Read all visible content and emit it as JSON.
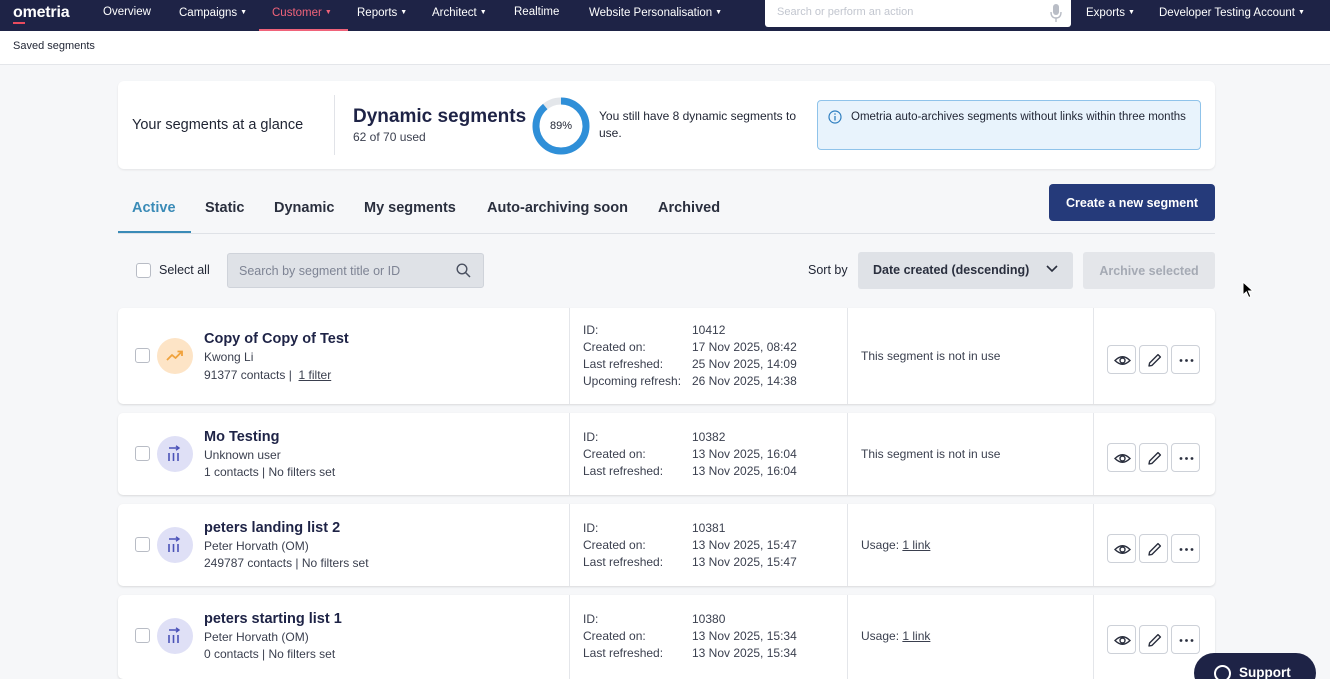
{
  "nav": {
    "logo": "ometria",
    "items": [
      {
        "label": "Overview",
        "dropdown": false
      },
      {
        "label": "Campaigns",
        "dropdown": true
      },
      {
        "label": "Customer",
        "dropdown": true,
        "active": true
      },
      {
        "label": "Reports",
        "dropdown": true
      },
      {
        "label": "Architect",
        "dropdown": true
      },
      {
        "label": "Realtime",
        "dropdown": false
      },
      {
        "label": "Website Personalisation",
        "dropdown": true
      }
    ],
    "search_placeholder": "Search or perform an action",
    "exports": "Exports",
    "account": "Developer Testing Account",
    "accent_color": "#f0637a",
    "bg_color": "#1e2346"
  },
  "breadcrumb": "Saved segments",
  "glance": {
    "title": "Your segments at a glance",
    "dynamic_title": "Dynamic segments",
    "used_text": "62 of 70 used",
    "used": 62,
    "total": 70,
    "percent_label": "89%",
    "percent": 0.89,
    "remaining_text": "You still have 8 dynamic segments to use.",
    "info_text": "Ometria auto-archives segments without links within three months"
  },
  "tabs": [
    {
      "label": "Active",
      "active": true
    },
    {
      "label": "Static"
    },
    {
      "label": "Dynamic"
    },
    {
      "label": "My segments"
    },
    {
      "label": "Auto-archiving soon"
    },
    {
      "label": "Archived"
    }
  ],
  "create_button": "Create a new segment",
  "filters": {
    "select_all": "Select all",
    "search_placeholder": "Search by segment title or ID",
    "sort_label": "Sort by",
    "sort_value": "Date created (descending)",
    "archive_button": "Archive selected"
  },
  "segments": [
    {
      "name": "Copy of Copy of Test",
      "owner": "Kwong Li",
      "contacts": "91377 contacts",
      "filters": "1 filter",
      "filters_link": true,
      "icon": "trending-up-icon",
      "icon_bg": "#fde4c6",
      "icon_color": "#f0a23c",
      "id_label": "ID:",
      "id": "10412",
      "created_label": "Created on:",
      "created": "17 Nov 2025, 08:42",
      "refreshed_label": "Last refreshed:",
      "refreshed": "25 Nov 2025, 14:09",
      "upcoming_label": "Upcoming refresh:",
      "upcoming": "26 Nov 2025, 14:38",
      "usage_prefix": "This segment is not in use",
      "usage_link": ""
    },
    {
      "name": "Mo Testing",
      "owner": "Unknown user",
      "contacts": "1 contacts",
      "filters": "No filters set",
      "filters_link": false,
      "icon": "static-list-icon",
      "icon_bg": "#dfe0f6",
      "icon_color": "#4b52b8",
      "id_label": "ID:",
      "id": "10382",
      "created_label": "Created on:",
      "created": "13 Nov 2025, 16:04",
      "refreshed_label": "Last refreshed:",
      "refreshed": "13 Nov 2025, 16:04",
      "usage_prefix": "This segment is not in use",
      "usage_link": ""
    },
    {
      "name": "peters landing list 2",
      "owner": "Peter Horvath (OM)",
      "contacts": "249787 contacts",
      "filters": "No filters set",
      "filters_link": false,
      "icon": "static-list-icon",
      "icon_bg": "#dfe0f6",
      "icon_color": "#4b52b8",
      "id_label": "ID:",
      "id": "10381",
      "created_label": "Created on:",
      "created": "13 Nov 2025, 15:47",
      "refreshed_label": "Last refreshed:",
      "refreshed": "13 Nov 2025, 15:47",
      "usage_prefix": "Usage:",
      "usage_link": "1 link"
    },
    {
      "name": "peters starting list 1",
      "owner": "Peter Horvath (OM)",
      "contacts": "0 contacts",
      "filters": "No filters set",
      "filters_link": false,
      "icon": "static-list-icon",
      "icon_bg": "#dfe0f6",
      "icon_color": "#4b52b8",
      "id_label": "ID:",
      "id": "10380",
      "created_label": "Created on:",
      "created": "13 Nov 2025, 15:34",
      "refreshed_label": "Last refreshed:",
      "refreshed": "13 Nov 2025, 15:34",
      "usage_prefix": "Usage:",
      "usage_link": "1 link"
    }
  ],
  "support": "Support"
}
